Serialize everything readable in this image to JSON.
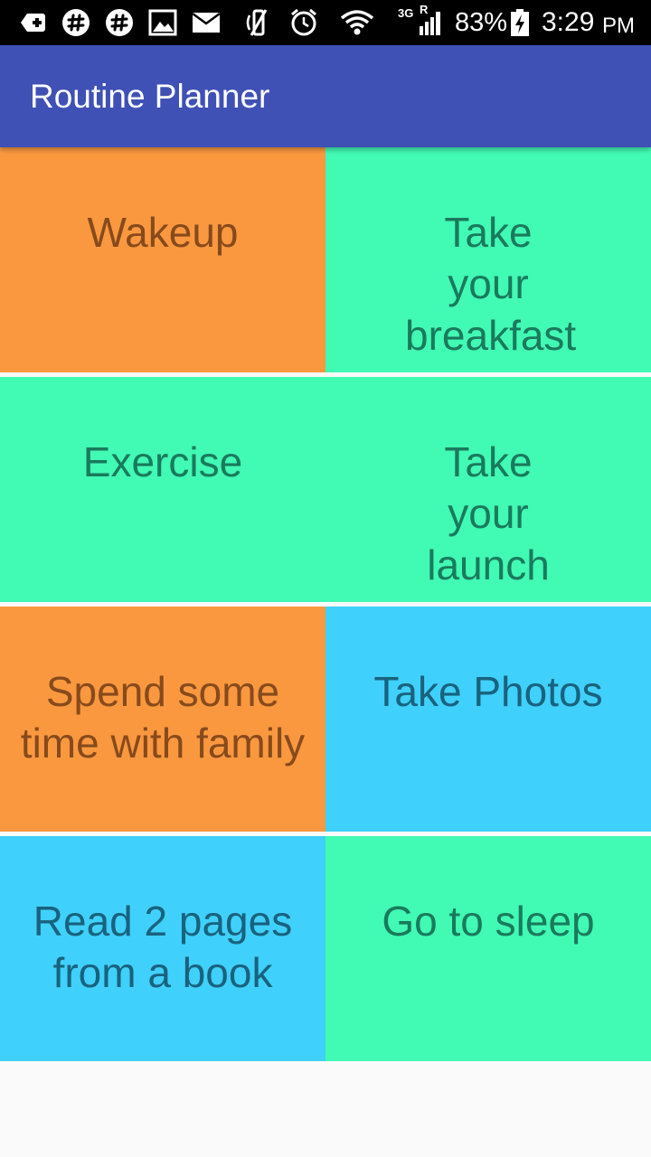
{
  "status_bar": {
    "network_type": "3G",
    "roaming": "R",
    "battery": "83%",
    "time": "3:29",
    "ampm": "PM",
    "icons": [
      "add-box-icon",
      "slack-icon",
      "slack-icon",
      "image-icon",
      "mail-icon",
      "mute-icon",
      "alarm-icon",
      "wifi-icon",
      "signal-icon",
      "battery-charging-icon"
    ]
  },
  "app_bar": {
    "title": "Routine Planner",
    "color": "#3f51b5"
  },
  "tiles": [
    {
      "label": "Wakeup",
      "color": "orange"
    },
    {
      "label": "Take your breakfast",
      "color": "green"
    },
    {
      "label": "Exercise",
      "color": "green"
    },
    {
      "label": "Take your launch",
      "color": "green"
    },
    {
      "label": "Spend some time with family",
      "color": "orange"
    },
    {
      "label": "Take Photos",
      "color": "blue"
    },
    {
      "label": "Read 2 pages from a book",
      "color": "blue"
    },
    {
      "label": "Go to sleep",
      "color": "green"
    }
  ],
  "colors": {
    "orange": "#fa983f",
    "green": "#41fab4",
    "blue": "#40d0fc"
  }
}
